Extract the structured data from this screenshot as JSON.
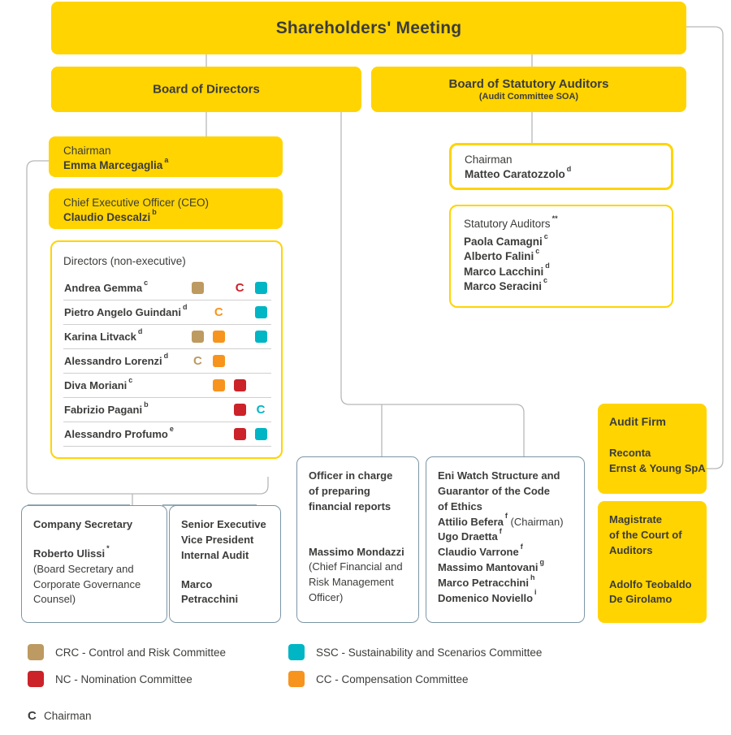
{
  "colors": {
    "yellow": "#FFD400",
    "crc_tan": "#BD9A61",
    "nc_red": "#CC2229",
    "ssc_teal": "#00B5C4",
    "cc_orange": "#F7941E",
    "grey_line": "#b8b8b8",
    "blue_grey": "#7b95a5",
    "text": "#3c3c3b"
  },
  "top": {
    "shareholders_meeting": "Shareholders' Meeting",
    "board_of_directors": "Board of Directors",
    "board_of_statutory_auditors": "Board of Statutory Auditors",
    "board_of_statutory_auditors_sub": "(Audit Committee SOA)"
  },
  "left_column": {
    "chairman": {
      "role": "Chairman",
      "name": "Emma Marcegaglia",
      "note": "a"
    },
    "ceo": {
      "role": "Chief Executive Officer (CEO)",
      "name": "Claudio Descalzi",
      "note": "b"
    },
    "directors": {
      "heading": "Directors (non-executive)",
      "rows": [
        {
          "name": "Andrea Gemma",
          "note": "c",
          "marks": [
            "square-crc",
            "",
            "C-nc",
            "square-ssc"
          ]
        },
        {
          "name": "Pietro Angelo Guindani",
          "note": "d",
          "marks": [
            "",
            "C-cc",
            "",
            "square-ssc"
          ]
        },
        {
          "name": "Karina Litvack",
          "note": "d",
          "marks": [
            "square-crc",
            "square-cc",
            "",
            "square-ssc"
          ]
        },
        {
          "name": "Alessandro Lorenzi",
          "note": "d",
          "marks": [
            "C-crc",
            "square-cc",
            "",
            ""
          ]
        },
        {
          "name": "Diva Moriani",
          "note": "c",
          "marks": [
            "",
            "square-cc",
            "square-nc",
            ""
          ]
        },
        {
          "name": "Fabrizio Pagani",
          "note": "b",
          "marks": [
            "",
            "",
            "square-nc",
            "C-ssc"
          ]
        },
        {
          "name": "Alessandro Profumo",
          "note": "e",
          "marks": [
            "",
            "",
            "square-nc",
            "square-ssc"
          ]
        }
      ]
    }
  },
  "right_column": {
    "chairman": {
      "role": "Chairman",
      "name": "Matteo Caratozzolo",
      "note": "d"
    },
    "statutory_auditors": {
      "heading": "Statutory Auditors",
      "heading_note": "**",
      "members": [
        {
          "name": "Paola Camagni",
          "note": "c"
        },
        {
          "name": "Alberto Falini",
          "note": "c"
        },
        {
          "name": "Marco Lacchini",
          "note": "d"
        },
        {
          "name": "Marco Seracini",
          "note": "c"
        }
      ]
    }
  },
  "bottom_boxes": {
    "company_secretary": {
      "title": "Company Secretary",
      "name": "Roberto Ulissi",
      "note": "*",
      "detail": "(Board Secretary and Corporate Governance Counsel)"
    },
    "internal_audit": {
      "title": "Senior Executive\nVice President\nInternal Audit",
      "title_lines": [
        "Senior Executive",
        "Vice President",
        "Internal Audit"
      ],
      "name": "Marco Petracchini"
    },
    "financial_reports_officer": {
      "title_lines": [
        "Officer in charge",
        "of preparing",
        "financial reports"
      ],
      "name": "Massimo  Mondazzi",
      "detail": "(Chief Financial and Risk Management Officer)"
    },
    "eni_watch": {
      "title_lines": [
        "Eni Watch Structure and",
        "Guarantor of the Code",
        "of Ethics"
      ],
      "members": [
        {
          "name": "Attilio Befera",
          "note": "f",
          "suffix": "(Chairman)"
        },
        {
          "name": "Ugo Draetta",
          "note": "f",
          "suffix": ""
        },
        {
          "name": "Claudio Varrone",
          "note": "f",
          "suffix": ""
        },
        {
          "name": "Massimo Mantovani",
          "note": "g",
          "suffix": ""
        },
        {
          "name": "Marco Petracchini",
          "note": "h",
          "suffix": ""
        },
        {
          "name": "Domenico Noviello",
          "note": "i",
          "suffix": ""
        }
      ]
    }
  },
  "right_boxes": {
    "audit_firm": {
      "title": "Audit Firm",
      "name_lines": [
        "Reconta",
        "Ernst & Young SpA"
      ]
    },
    "magistrate": {
      "title_lines": [
        "Magistrate",
        "of the Court of",
        "Auditors"
      ],
      "name_lines": [
        "Adolfo Teobaldo",
        "De Girolamo"
      ]
    }
  },
  "legend": {
    "items": [
      {
        "swatch": "crc_tan",
        "label": "CRC - Control and Risk Committee",
        "col": 0,
        "row": 0
      },
      {
        "swatch": "ssc_teal",
        "label": "SSC - Sustainability and Scenarios Committee",
        "col": 1,
        "row": 0
      },
      {
        "swatch": "nc_red",
        "label": "NC - Nomination Committee",
        "col": 0,
        "row": 1
      },
      {
        "swatch": "cc_orange",
        "label": "CC - Compensation Committee",
        "col": 1,
        "row": 1
      }
    ],
    "chairman_marker": "C",
    "chairman_label": "Chairman"
  }
}
